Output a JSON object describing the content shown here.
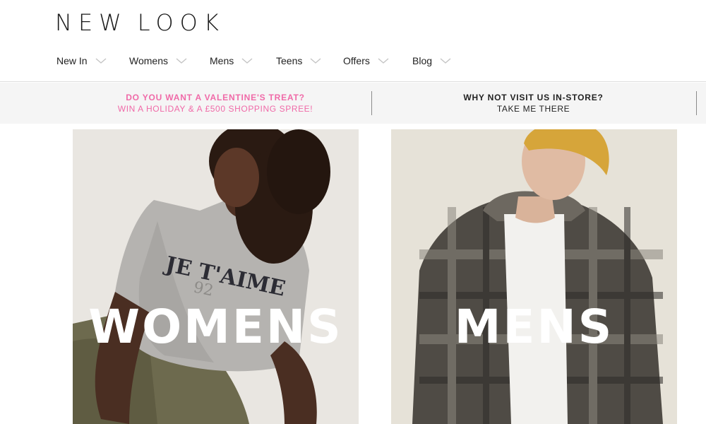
{
  "brand": {
    "logo_word1": "NEW",
    "logo_word2": "LOOK"
  },
  "nav": {
    "items": [
      {
        "label": "New In",
        "icon": "chevron-down-icon"
      },
      {
        "label": "Womens",
        "icon": "chevron-down-icon"
      },
      {
        "label": "Mens",
        "icon": "chevron-down-icon"
      },
      {
        "label": "Teens",
        "icon": "chevron-down-icon"
      },
      {
        "label": "Offers",
        "icon": "chevron-down-icon"
      },
      {
        "label": "Blog",
        "icon": "chevron-down-icon"
      }
    ]
  },
  "promo": {
    "left": {
      "title": "DO YOU WANT A VALENTINE'S TREAT?",
      "subtitle": "WIN A HOLIDAY & A £500 SHOPPING SPREE!"
    },
    "right": {
      "title": "WHY NOT VISIT US IN-STORE?",
      "subtitle": "TAKE ME THERE"
    }
  },
  "tiles": {
    "women": {
      "label": "WOMENS"
    },
    "men": {
      "label": "MENS"
    }
  },
  "colors": {
    "promo_pink": "#f06aa8",
    "promo_background": "#f5f5f5",
    "text_dark": "#222222"
  }
}
